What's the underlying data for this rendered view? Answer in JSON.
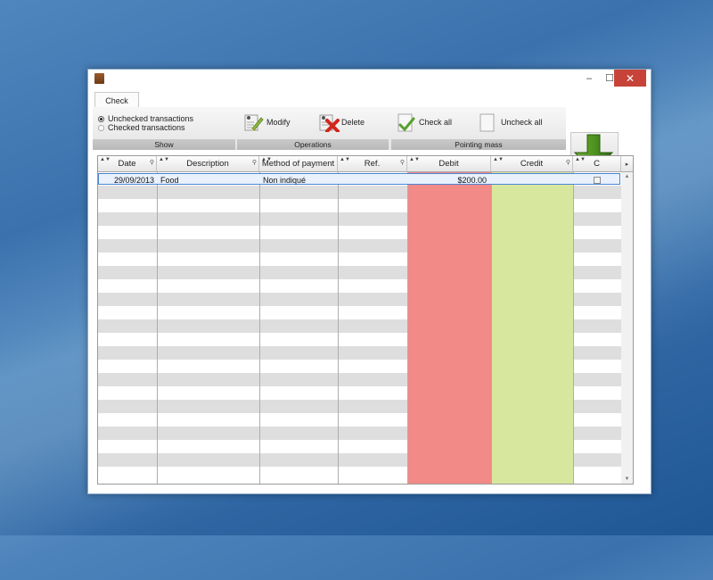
{
  "window": {
    "minimize_label": "–",
    "maximize_label": "☐",
    "close_label": "✕"
  },
  "tabs": [
    {
      "label": "Check"
    }
  ],
  "ribbon": {
    "show": {
      "label": "Show",
      "options": [
        {
          "label": "Unchecked transactions",
          "selected": true
        },
        {
          "label": "Checked transactions",
          "selected": false
        }
      ]
    },
    "operations": {
      "label": "Operations",
      "buttons": [
        {
          "label": "Modify",
          "icon": "modify-pencil-icon"
        },
        {
          "label": "Delete",
          "icon": "delete-x-icon"
        }
      ]
    },
    "pointing_mass": {
      "label": "Pointing mass",
      "buttons": [
        {
          "label": "Check all",
          "icon": "check-all-icon"
        },
        {
          "label": "Uncheck all",
          "icon": "uncheck-all-icon"
        }
      ]
    },
    "down_arrow_icon": "green-down-arrow-icon"
  },
  "grid": {
    "columns": [
      "Date",
      "Description",
      "Method of payment",
      "Ref.",
      "Debit",
      "Credit",
      "C"
    ],
    "rows": [
      {
        "date": "29/09/2013",
        "description": "Food",
        "method": "Non indiqué",
        "ref": "",
        "debit": "$200.00",
        "credit": "",
        "checked": false
      }
    ],
    "colors": {
      "debit": "#f28a87",
      "credit": "#d7e79e",
      "selected_border": "#4b86d6"
    }
  }
}
